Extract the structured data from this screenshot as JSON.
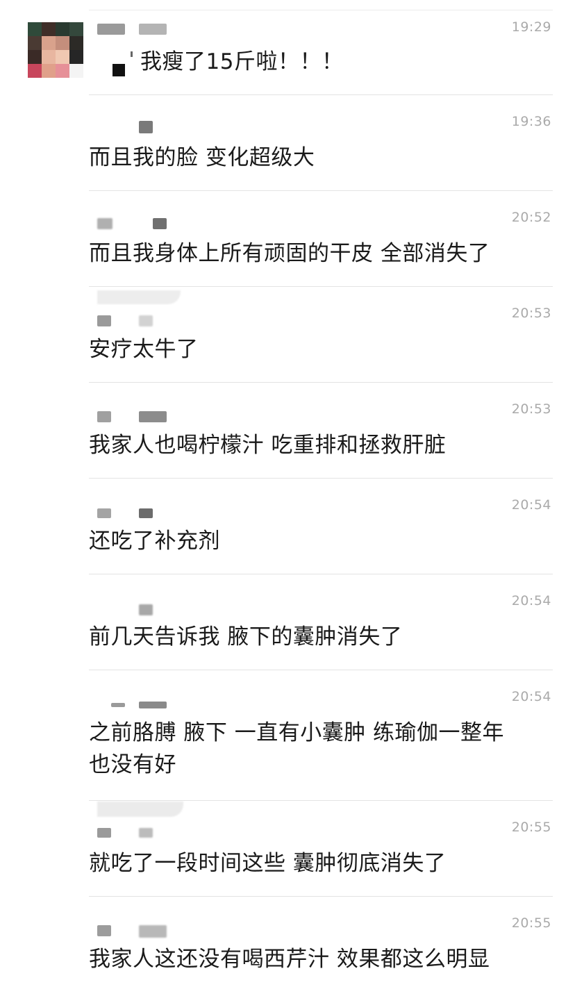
{
  "messages": [
    {
      "time": "19:29",
      "text": "我瘦了15斤啦！！！"
    },
    {
      "time": "19:36",
      "text": "而且我的脸 变化超级大"
    },
    {
      "time": "20:52",
      "text": "而且我身体上所有顽固的干皮 全部消失了"
    },
    {
      "time": "20:53",
      "text": "安疗太牛了"
    },
    {
      "time": "20:53",
      "text": "我家人也喝柠檬汁 吃重排和拯救肝脏"
    },
    {
      "time": "20:54",
      "text": "还吃了补充剂"
    },
    {
      "time": "20:54",
      "text": "前几天告诉我 腋下的囊肿消失了"
    },
    {
      "time": "20:54",
      "text": "之前胳膊 腋下 一直有小囊肿 练瑜伽一整年\n也没有好"
    },
    {
      "time": "20:55",
      "text": "就吃了一段时间这些 囊肿彻底消失了"
    },
    {
      "time": "20:55",
      "text": "我家人这还没有喝西芹汁 效果都这么明显"
    }
  ],
  "colors": {
    "text": "#1a1a1a",
    "time": "#aaaaaa",
    "separator": "#e3e3e3",
    "background": "#ffffff"
  }
}
